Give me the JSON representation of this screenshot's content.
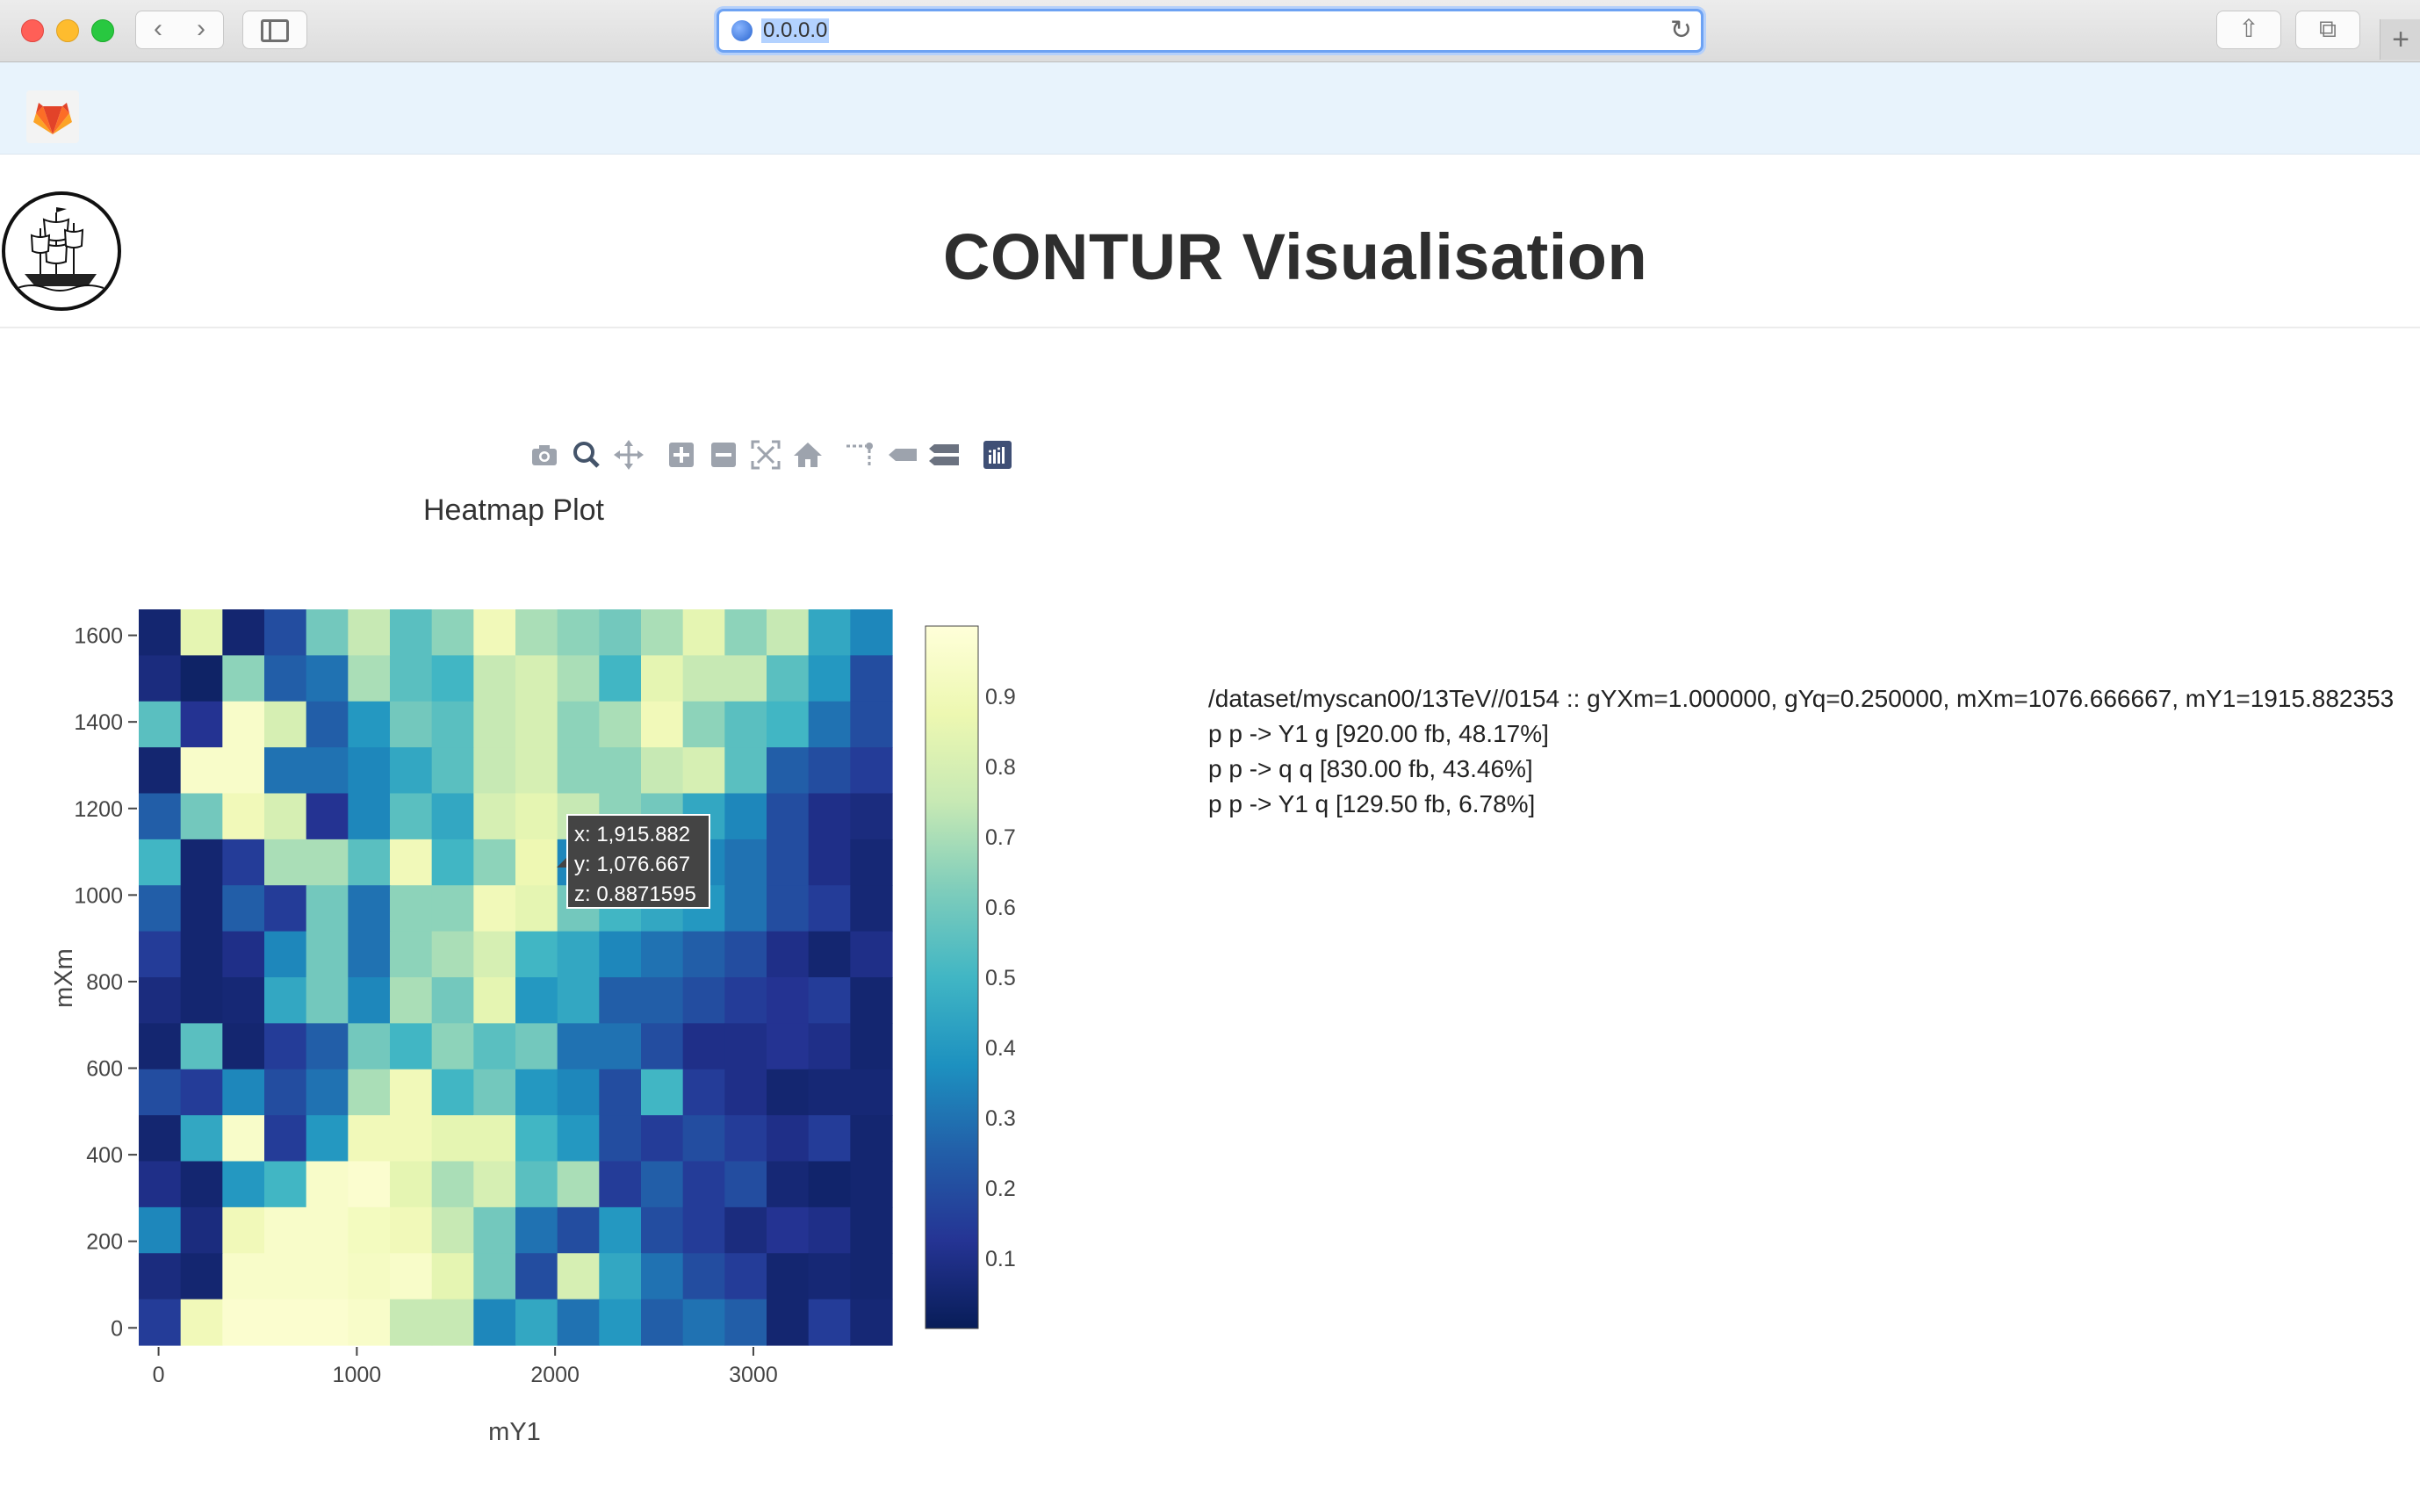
{
  "browser": {
    "url": "0.0.0.0"
  },
  "page": {
    "title": "CONTUR Visualisation"
  },
  "plot": {
    "title": "Heatmap Plot",
    "tooltip": {
      "x": "x: 1,915.882",
      "y": "y: 1,076.667",
      "z": "z: 0.8871595"
    }
  },
  "info": {
    "lines": [
      "/dataset/myscan00/13TeV//0154 :: gYXm=1.000000, gYq=0.250000, mXm=1076.666667, mY1=1915.882353",
      "p p -> Y1 g [920.00 fb, 48.17%]",
      "p p -> q q [830.00 fb, 43.46%]",
      "p p -> Y1 q [129.50 fb, 6.78%]"
    ]
  },
  "chart_data": {
    "type": "heatmap",
    "title": "Heatmap Plot",
    "xlabel": "mY1",
    "ylabel": "mXm",
    "x_ticks": [
      "0",
      "1000",
      "2000",
      "3000"
    ],
    "y_ticks": [
      "0",
      "200",
      "400",
      "600",
      "800",
      "1000",
      "1200",
      "1400",
      "1600"
    ],
    "xlim": [
      -100,
      3700
    ],
    "ylim": [
      -40,
      1660
    ],
    "colorbar_ticks": [
      "0.1",
      "0.2",
      "0.3",
      "0.4",
      "0.5",
      "0.6",
      "0.7",
      "0.8",
      "0.9"
    ],
    "colorscale": "YlGnBu",
    "z_rows_top_to_bottom": [
      [
        0.05,
        0.85,
        0.05,
        0.2,
        0.6,
        0.75,
        0.55,
        0.65,
        0.9,
        0.7,
        0.65,
        0.6,
        0.7,
        0.85,
        0.65,
        0.75,
        0.45,
        0.35
      ],
      [
        0.08,
        0.03,
        0.65,
        0.25,
        0.3,
        0.7,
        0.55,
        0.5,
        0.75,
        0.8,
        0.7,
        0.5,
        0.85,
        0.75,
        0.75,
        0.55,
        0.4,
        0.2
      ],
      [
        0.55,
        0.12,
        0.95,
        0.8,
        0.25,
        0.4,
        0.6,
        0.55,
        0.75,
        0.8,
        0.65,
        0.7,
        0.9,
        0.65,
        0.55,
        0.5,
        0.3,
        0.2
      ],
      [
        0.05,
        0.95,
        0.95,
        0.3,
        0.3,
        0.35,
        0.45,
        0.55,
        0.75,
        0.8,
        0.65,
        0.65,
        0.75,
        0.8,
        0.55,
        0.25,
        0.2,
        0.15
      ],
      [
        0.25,
        0.6,
        0.9,
        0.8,
        0.12,
        0.35,
        0.55,
        0.45,
        0.8,
        0.85,
        0.75,
        0.65,
        0.6,
        0.45,
        0.35,
        0.2,
        0.1,
        0.08
      ],
      [
        0.5,
        0.05,
        0.15,
        0.7,
        0.7,
        0.55,
        0.9,
        0.5,
        0.65,
        0.88,
        0.35,
        0.55,
        0.35,
        0.35,
        0.3,
        0.2,
        0.1,
        0.06
      ],
      [
        0.25,
        0.05,
        0.25,
        0.15,
        0.6,
        0.3,
        0.65,
        0.65,
        0.9,
        0.85,
        0.6,
        0.5,
        0.45,
        0.4,
        0.3,
        0.2,
        0.15,
        0.06
      ],
      [
        0.15,
        0.05,
        0.1,
        0.35,
        0.6,
        0.3,
        0.65,
        0.7,
        0.8,
        0.5,
        0.45,
        0.35,
        0.3,
        0.25,
        0.2,
        0.1,
        0.05,
        0.1
      ],
      [
        0.08,
        0.05,
        0.06,
        0.45,
        0.6,
        0.35,
        0.7,
        0.6,
        0.85,
        0.4,
        0.45,
        0.25,
        0.25,
        0.2,
        0.15,
        0.12,
        0.15,
        0.05
      ],
      [
        0.05,
        0.55,
        0.05,
        0.15,
        0.25,
        0.6,
        0.5,
        0.65,
        0.55,
        0.6,
        0.3,
        0.3,
        0.2,
        0.1,
        0.1,
        0.12,
        0.1,
        0.05
      ],
      [
        0.2,
        0.15,
        0.35,
        0.2,
        0.3,
        0.7,
        0.9,
        0.5,
        0.6,
        0.4,
        0.35,
        0.2,
        0.5,
        0.15,
        0.1,
        0.05,
        0.06,
        0.06
      ],
      [
        0.05,
        0.45,
        0.95,
        0.15,
        0.4,
        0.9,
        0.9,
        0.85,
        0.85,
        0.5,
        0.4,
        0.2,
        0.15,
        0.2,
        0.15,
        0.1,
        0.15,
        0.05
      ],
      [
        0.1,
        0.05,
        0.4,
        0.5,
        0.95,
        0.97,
        0.85,
        0.7,
        0.8,
        0.55,
        0.7,
        0.15,
        0.25,
        0.15,
        0.2,
        0.06,
        0.04,
        0.05
      ],
      [
        0.35,
        0.08,
        0.9,
        0.95,
        0.95,
        0.92,
        0.9,
        0.75,
        0.6,
        0.3,
        0.2,
        0.4,
        0.2,
        0.15,
        0.08,
        0.12,
        0.1,
        0.05
      ],
      [
        0.08,
        0.05,
        0.95,
        0.95,
        0.95,
        0.93,
        0.95,
        0.85,
        0.6,
        0.2,
        0.8,
        0.45,
        0.3,
        0.2,
        0.15,
        0.05,
        0.06,
        0.05
      ],
      [
        0.15,
        0.9,
        0.97,
        0.97,
        0.97,
        0.95,
        0.75,
        0.75,
        0.35,
        0.45,
        0.3,
        0.4,
        0.25,
        0.3,
        0.25,
        0.05,
        0.15,
        0.06
      ]
    ]
  }
}
